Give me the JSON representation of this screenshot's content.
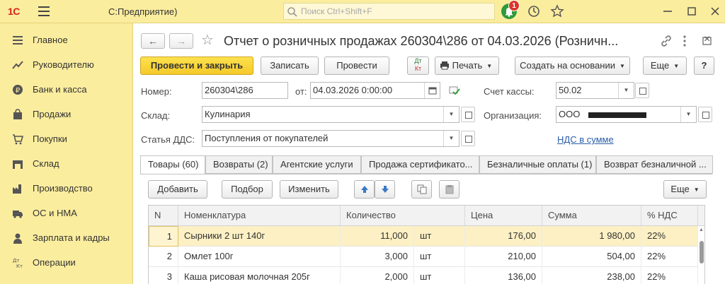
{
  "app": {
    "logo": "1С",
    "title": "С:Предприятие)",
    "search_placeholder": "Поиск Ctrl+Shift+F",
    "notifications_count": "1"
  },
  "sidebar": {
    "items": [
      {
        "label": "Главное",
        "icon": "menu-lines-icon"
      },
      {
        "label": "Руководителю",
        "icon": "trend-chart-icon"
      },
      {
        "label": "Банк и касса",
        "icon": "ruble-coin-icon"
      },
      {
        "label": "Продажи",
        "icon": "shopping-bag-icon"
      },
      {
        "label": "Покупки",
        "icon": "cart-icon"
      },
      {
        "label": "Склад",
        "icon": "warehouse-icon"
      },
      {
        "label": "Производство",
        "icon": "factory-icon"
      },
      {
        "label": "ОС и НМА",
        "icon": "truck-icon"
      },
      {
        "label": "Зарплата и кадры",
        "icon": "person-icon"
      },
      {
        "label": "Операции",
        "icon": "dt-kt-icon"
      }
    ]
  },
  "form": {
    "title": "Отчет о розничных продажах 260304\\286  от 04.03.2026 (Розничн...",
    "toolbar": {
      "post_close": "Провести и закрыть",
      "save": "Записать",
      "post": "Провести",
      "dtkt_top": "Дт",
      "dtkt_bottom": "Кт",
      "print": "Печать",
      "create_based": "Создать на основании",
      "more": "Еще",
      "help": "?"
    },
    "fields": {
      "number_label": "Номер:",
      "number_value": "260304\\286",
      "date_label": "от:",
      "date_value": "04.03.2026  0:00:00",
      "cash_account_label": "Счет кассы:",
      "cash_account_value": "50.02",
      "warehouse_label": "Склад:",
      "warehouse_value": "Кулинария",
      "organization_label": "Организация:",
      "organization_value": "ООО",
      "dds_label": "Статья ДДС:",
      "dds_value": "Поступления от покупателей",
      "vat_link": "НДС в сумме"
    },
    "tabs": [
      "Товары (60)",
      "Возвраты (2)",
      "Агентские услуги",
      "Продажа сертификато...",
      "Безналичные оплаты (1)",
      "Возврат безналичной ..."
    ],
    "table_toolbar": {
      "add": "Добавить",
      "pick": "Подбор",
      "edit": "Изменить",
      "more": "Еще"
    },
    "table": {
      "columns": [
        "N",
        "Номенклатура",
        "Количество",
        "Цена",
        "Сумма",
        "% НДС"
      ],
      "rows": [
        {
          "n": "1",
          "item": "Сырники 2 шт 140г",
          "qty": "11,000",
          "unit": "шт",
          "price": "176,00",
          "sum": "1 980,00",
          "vat": "22%"
        },
        {
          "n": "2",
          "item": "Омлет 100г",
          "qty": "3,000",
          "unit": "шт",
          "price": "210,00",
          "sum": "504,00",
          "vat": "22%"
        },
        {
          "n": "3",
          "item": "Каша рисовая молочная 205г",
          "qty": "2,000",
          "unit": "шт",
          "price": "136,00",
          "sum": "238,00",
          "vat": "22%"
        }
      ]
    }
  },
  "colors": {
    "accent_yellow": "#fbed9e",
    "primary_button": "#f4c92a",
    "link": "#2b5da8",
    "selected_row": "#fcf0c4"
  }
}
